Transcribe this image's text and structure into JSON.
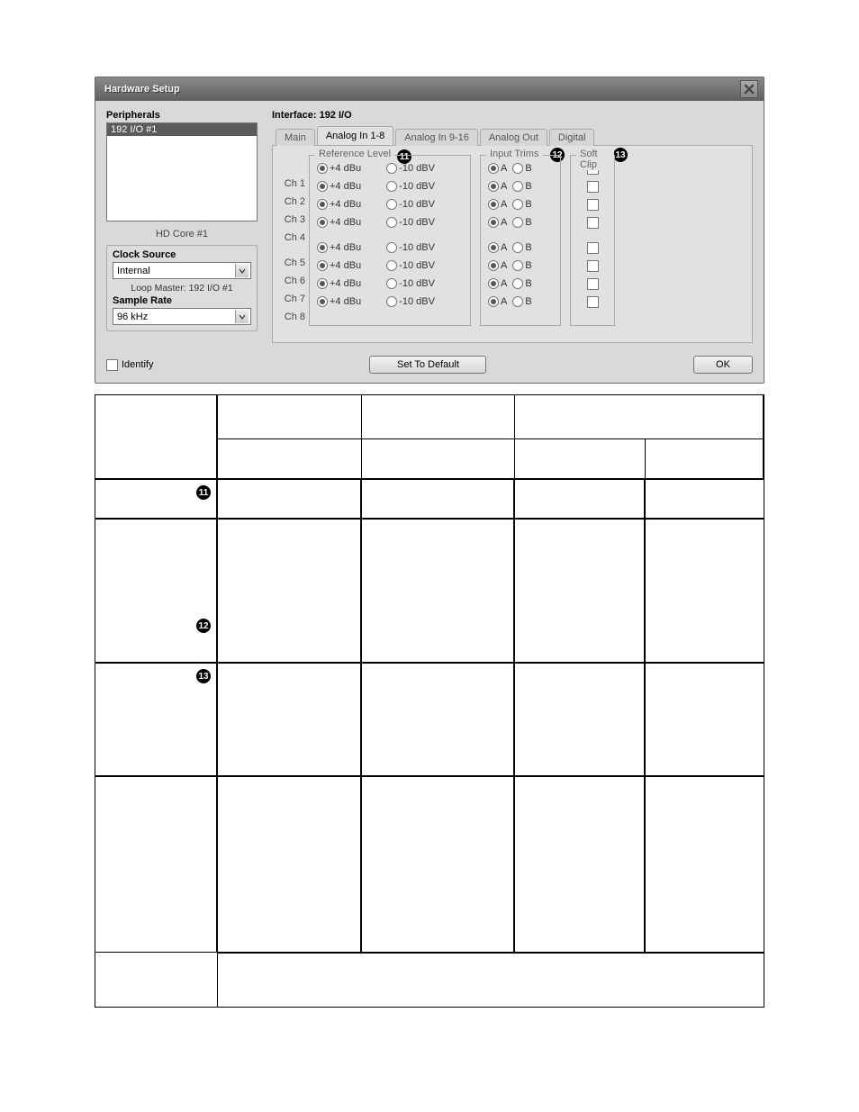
{
  "dialog": {
    "title": "Hardware Setup"
  },
  "peripherals": {
    "label": "Peripherals",
    "items": [
      "192 I/O #1"
    ],
    "core": "HD Core #1"
  },
  "clock": {
    "label": "Clock Source",
    "value": "Internal",
    "loop_master": "Loop Master: 192 I/O #1"
  },
  "sample_rate": {
    "label": "Sample Rate",
    "value": "96 kHz"
  },
  "interface": {
    "label": "Interface:  192 I/O",
    "tabs": [
      "Main",
      "Analog In 1-8",
      "Analog In 9-16",
      "Analog Out",
      "Digital"
    ],
    "active_tab": 1,
    "groups": {
      "reference": "Reference Level",
      "trims": "Input Trims",
      "clip": "Soft Clip"
    },
    "ref_opts": {
      "a": "+4 dBu",
      "b": "-10 dBV"
    },
    "trim_opts": {
      "a": "A",
      "b": "B"
    },
    "channels": [
      {
        "name": "Ch 1",
        "ref": "+4",
        "trim": "A",
        "clip": false
      },
      {
        "name": "Ch 2",
        "ref": "+4",
        "trim": "A",
        "clip": false
      },
      {
        "name": "Ch 3",
        "ref": "+4",
        "trim": "A",
        "clip": false
      },
      {
        "name": "Ch 4",
        "ref": "+4",
        "trim": "A",
        "clip": false
      },
      {
        "name": "Ch 5",
        "ref": "+4",
        "trim": "A",
        "clip": false
      },
      {
        "name": "Ch 6",
        "ref": "+4",
        "trim": "A",
        "clip": false
      },
      {
        "name": "Ch 7",
        "ref": "+4",
        "trim": "A",
        "clip": false
      },
      {
        "name": "Ch 8",
        "ref": "+4",
        "trim": "A",
        "clip": false
      }
    ]
  },
  "callouts": {
    "ref": "11",
    "trims": "12",
    "clip": "13"
  },
  "footer": {
    "identify": "Identify",
    "default": "Set To Default",
    "ok": "OK"
  },
  "table_callouts": {
    "r2": "11",
    "r3": "12",
    "r4": "13"
  }
}
